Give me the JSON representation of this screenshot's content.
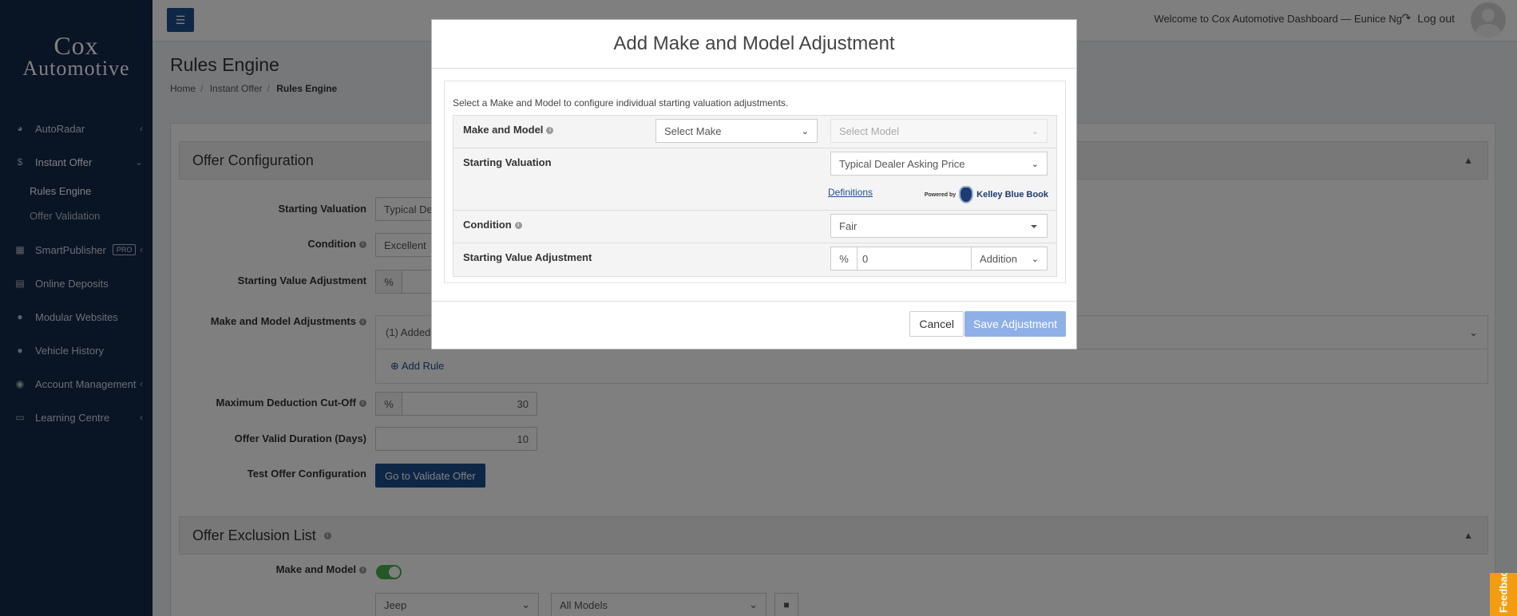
{
  "logo": {
    "line1": "Cox",
    "line2": "Automotive"
  },
  "sidebar": {
    "items": [
      {
        "label": "AutoRadar",
        "icon": "gauge-icon"
      },
      {
        "label": "Instant Offer",
        "icon": "dollar-icon"
      },
      {
        "label": "SmartPublisher",
        "icon": "car-icon",
        "badge": "PRO"
      },
      {
        "label": "Online Deposits",
        "icon": "card-icon"
      },
      {
        "label": "Modular Websites",
        "icon": "globe-icon"
      },
      {
        "label": "Vehicle History",
        "icon": "dot-icon"
      },
      {
        "label": "Account Management",
        "icon": "user-circle-icon"
      },
      {
        "label": "Learning Centre",
        "icon": "book-icon"
      }
    ],
    "sub_items": [
      {
        "label": "Rules Engine"
      },
      {
        "label": "Offer Validation"
      }
    ]
  },
  "topbar": {
    "welcome": "Welcome to Cox Automotive Dashboard — Eunice Ng",
    "logout": "Log out"
  },
  "page": {
    "title": "Rules Engine",
    "breadcrumb": [
      "Home",
      "Instant Offer",
      "Rules Engine"
    ]
  },
  "offer_config": {
    "title": "Offer Configuration",
    "starting_valuation_label": "Starting Valuation",
    "starting_valuation_value": "Typical De",
    "condition_label": "Condition",
    "condition_value": "Excellent",
    "starting_value_adjustment_label": "Starting Value Adjustment",
    "percent": "%",
    "make_model_adjustments_label": "Make and Model Adjustments",
    "added_text": "(1) Added",
    "add_rule": "Add Rule",
    "max_deduction_label": "Maximum Deduction Cut-Off",
    "max_deduction_value": "30",
    "valid_duration_label": "Offer Valid Duration (Days)",
    "valid_duration_value": "10",
    "test_label": "Test Offer Configuration",
    "validate_button": "Go to Validate Offer"
  },
  "exclusion": {
    "title": "Offer Exclusion List",
    "make_model_label": "Make and Model",
    "make_value": "Jeep",
    "model_value": "All Models"
  },
  "modal": {
    "title": "Add Make and Model Adjustment",
    "intro": "Select a Make and Model to configure individual starting valuation adjustments.",
    "make_model_label": "Make and Model",
    "make_select": "Select Make",
    "model_select": "Select Model",
    "starting_valuation_label": "Starting Valuation",
    "starting_valuation_value": "Typical Dealer Asking Price",
    "definitions": "Definitions",
    "powered_by": "Powered by",
    "kbb": "Kelley Blue Book",
    "condition_label": "Condition",
    "condition_value": "Fair",
    "adjustment_label": "Starting Value Adjustment",
    "percent": "%",
    "adjustment_value": "0",
    "adjustment_type": "Addition",
    "cancel": "Cancel",
    "save": "Save Adjustment"
  },
  "feedback": "Feedback",
  "colors": {
    "sidebar": "#13294b",
    "primary": "#1f4e8c",
    "save_disabled": "#8fb0e6",
    "toggle_on": "#4caf50",
    "feedback": "#f39c12"
  }
}
